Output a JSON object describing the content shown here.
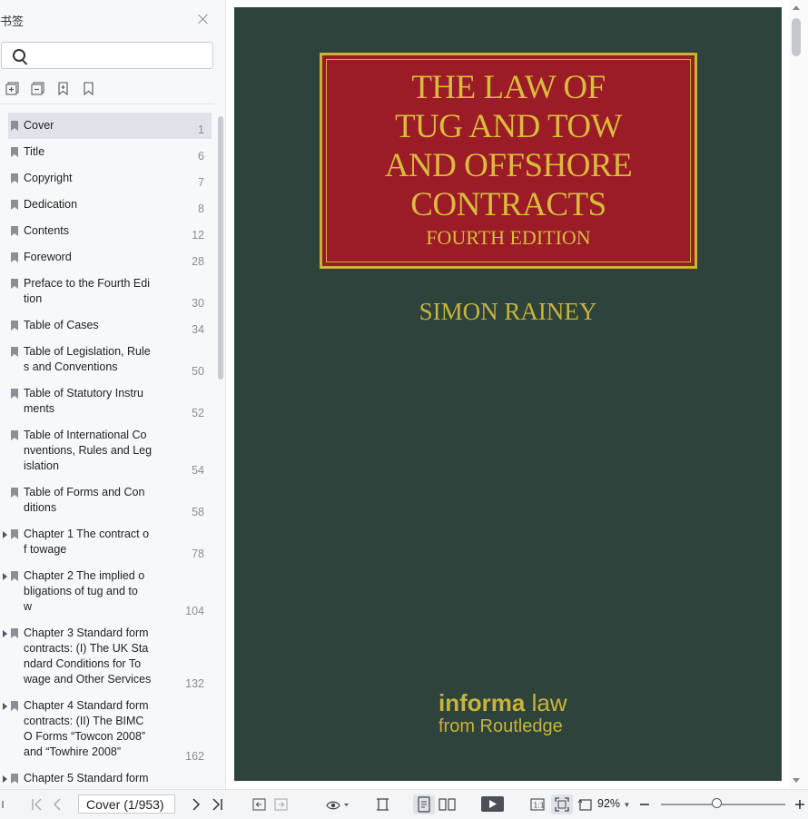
{
  "panel": {
    "title": "书签",
    "search": {
      "value": "",
      "placeholder": ""
    },
    "tools": [
      "expand-all-icon",
      "collapse-all-icon",
      "add-bookmark-icon",
      "bookmark-icon"
    ],
    "items": [
      {
        "label": "Cover",
        "page": "1",
        "selected": true,
        "expandable": false
      },
      {
        "label": "Title",
        "page": "6",
        "expandable": false
      },
      {
        "label": "Copyright",
        "page": "7",
        "expandable": false
      },
      {
        "label": "Dedication",
        "page": "8",
        "expandable": false
      },
      {
        "label": "Contents",
        "page": "12",
        "expandable": false
      },
      {
        "label": "Foreword",
        "page": "28",
        "expandable": false
      },
      {
        "label": "Preface to the Fourth Edi\ntion",
        "page": "30",
        "expandable": false
      },
      {
        "label": "Table of Cases",
        "page": "34",
        "expandable": false
      },
      {
        "label": "Table of Legislation, Rule\ns and Conventions",
        "page": "50",
        "expandable": false
      },
      {
        "label": "Table of Statutory Instru\nments",
        "page": "52",
        "expandable": false
      },
      {
        "label": "Table of International Co\nnventions, Rules and Leg\nislation",
        "page": "54",
        "expandable": false
      },
      {
        "label": "Table of Forms and Con\nditions",
        "page": "58",
        "expandable": false
      },
      {
        "label": "Chapter 1 The contract o\nf towage",
        "page": "78",
        "expandable": true
      },
      {
        "label": "Chapter 2 The implied o\nbligations of tug and to\nw",
        "page": "104",
        "expandable": true
      },
      {
        "label": "Chapter 3 Standard form\ncontracts: (I) The UK Sta\nndard Conditions for To\nwage and Other Services",
        "page": "132",
        "expandable": true
      },
      {
        "label": "Chapter 4 Standard form\ncontracts: (II) The BIMC\nO Forms “Towcon 2008”\nand “Towhire 2008”",
        "page": "162",
        "expandable": true
      },
      {
        "label": "Chapter 5 Standard form",
        "page": "",
        "expandable": true
      }
    ]
  },
  "document": {
    "title": "THE LAW OF\nTUG AND TOW\nAND OFFSHORE\nCONTRACTS",
    "edition": "FOURTH EDITION",
    "author": "SIMON RAINEY",
    "publisher_brand_bold": "informa",
    "publisher_brand_light": " law",
    "publisher_line": "from Routledge",
    "colors": {
      "cover": "#2d433b",
      "title_panel": "#9b1b26",
      "gold": "#c9b43a"
    }
  },
  "statusbar": {
    "page_box": "Cover (1/953)",
    "zoom": "92%",
    "zoom_level_percent": 92
  }
}
